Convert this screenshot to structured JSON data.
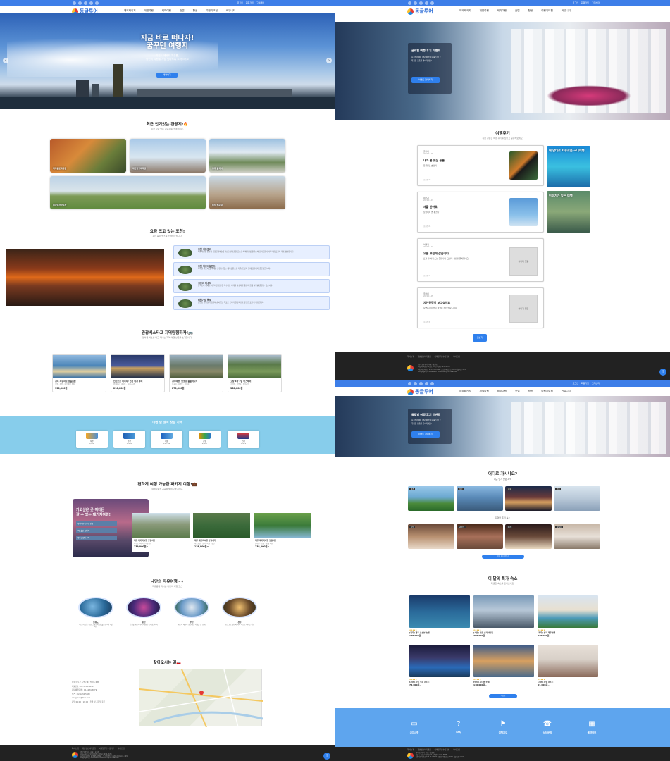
{
  "brand": {
    "logo_text": "동글투어"
  },
  "topbar": {
    "util": [
      "로그인",
      "회원가입",
      "고객센터"
    ]
  },
  "nav": {
    "menu": [
      "해외패키지",
      "개별여행",
      "테마여행",
      "호텔",
      "항공",
      "여행지보험",
      "커뮤니티"
    ]
  },
  "home": {
    "hero": {
      "line1": "지금 바로 떠나자!",
      "line2": "꿈꾸던 여행지",
      "sub1": "지친 나에게도 자유를,",
      "sub2": "당신의 여행을 가장 빛나도록 도와드려요",
      "button": "예약하기"
    },
    "popular": {
      "title": "최근 인기있는 관광지!🔥",
      "sub": "지금 사랑 받는 관광지를 소개합니다.",
      "items": [
        "제주돌문화공원",
        "대관령양떼목장",
        "경주 불국사",
        "울산 간절곶",
        "대관령삼양목장",
        "부산 해운대"
      ]
    },
    "recommend": {
      "title": "요즘 뜨고 있는 포천!",
      "sub": "포천 숨은 명소를 소개해드립니다.",
      "items": [
        {
          "name": "포천 아트밸리",
          "desc": "폐채석장을 친환경 복합문화예술공간으로 탈바꿈한 곳으로 에메랄드빛 천주호와 조각공원이 어우러진 포천의 대표 명소입니다."
        },
        {
          "name": "포천 허브아일랜드",
          "desc": "사계절 허브와 빛 축제를 즐길 수 있는 테마공원으로 가족, 연인과 함께 방문하기 좋은 곳입니다."
        },
        {
          "name": "고모리 저수지",
          "desc": "산책로와 카페가 어우러진 조용한 저수지로 사계절 아름다운 풍경과 함께 여유를 즐길 수 있습니다."
        },
        {
          "name": "비둘기낭 폭포",
          "desc": "한탄강 주상절리 협곡에 숨어있는 폭포로 드라마 촬영지로도 유명한 포천의 비경입니다."
        }
      ]
    },
    "tours": {
      "title": "관광버스타고 지역탐험하자!🚌",
      "sub": "편하게 버스를 타고 떠나는 지역 여행 상품을 소개합니다.",
      "items": [
        {
          "name": "경북 자동차로 당일출발",
          "sub": "포항 · 경주 · 울산 해안 투어",
          "price": "138,000원~"
        },
        {
          "name": "인천으로 떠나자! 인천 야경 투어",
          "sub": "인천대교 · 월미도 · 차이나타운",
          "price": "210,000원~"
        },
        {
          "name": "경주여행, 안호로 출발하자!",
          "sub": "불국사 · 석굴암 · 첨성대",
          "price": "273,000원~"
        },
        {
          "name": "고창 1박 2일 버스투어",
          "sub": "고인돌 · 선운사 · 청보리밭",
          "price": "358,000원~"
        }
      ]
    },
    "regions": {
      "title": "이번 달 많이 찾은 지역",
      "items": [
        {
          "name": "제주",
          "value": "3,250"
        },
        {
          "name": "부산",
          "value": "5,420"
        },
        {
          "name": "서울",
          "value": "15,769"
        },
        {
          "name": "강원",
          "value": "2,457"
        },
        {
          "name": "인천",
          "value": "3,474"
        }
      ]
    },
    "package": {
      "title": "편하게 여행 가능한 패키지 여행!💼",
      "sub": "여행상품을 꼼꼼하게 비교해드려요.",
      "promo_line1": "가고싶은 곳 어디든",
      "promo_line2": "갈 수 있는 패키지여행!",
      "options": [
        "해외여행 패키지, 전체",
        "2명 출발, 성인2",
        "예약 출발일, 1박"
      ],
      "items": [
        {
          "name": "제주 패키지여행 당일치기",
          "sub": "제주도 2박 3일 자유여행",
          "price": "139,000원~"
        },
        {
          "name": "제주 패키지여행 당일치기",
          "sub": "미로공원 · 동백수목원 · 성산",
          "price": "138,000원~"
        },
        {
          "name": "제주 패키지여행 당일치기",
          "sub": "한라산 · 오름 · 협재 해변",
          "price": "138,000원~"
        }
      ]
    },
    "free": {
      "title": "나만의 자유여행~✈",
      "sub": "자유롭게 떠나는 나만의 여행 코스",
      "items": [
        {
          "name": "울릉도",
          "desc": "때 묻지 않은 자연 그대로의 섬, 울릉도 2박 3일 여행"
        },
        {
          "name": "울산",
          "desc": "간절곶 해돋이부터 태화강 국가정원까지"
        },
        {
          "name": "부산",
          "desc": "해운대 해변과 광안대교 야경을 한 번에"
        },
        {
          "name": "경주",
          "desc": "천년 고도 경주의 역사 속으로 떠나는 여행"
        }
      ]
    },
    "location": {
      "title": "찾아오시는 길🚗",
      "lines": [
        "서울 마포구 독막로 67 망원동 686",
        "대표번호 : 02-1234-5678",
        "대량예약문의 : 02-1234-5679",
        "팩스 : 02-1234-5680",
        "dongglue@tour.com",
        "평일 09:00 - 18:00 · 주말 및 공휴일 휴무"
      ]
    }
  },
  "review": {
    "hero": {
      "title": "글로벌 여행 후기 이벤트",
      "desc1": "동글투어에서 떠난 여행 후기를 남기고",
      "desc2": "푸짐한 경품을 받아가세요!",
      "button": "이벤트 참여하기"
    },
    "section": {
      "title": "여행후기",
      "sub": "직접 경험한 여행 후기를 남기고 공유해보세요."
    },
    "items": [
      {
        "user": "글쓴이",
        "date": "2022-11-09",
        "head": "내가 본 멋진 동물",
        "body": "동물원도 호랑이",
        "views": "조회수 26",
        "image": true
      },
      {
        "user": "여우개",
        "date": "2022-11-07",
        "head": "새를 받아요",
        "body": "남극에서 본 펭귄들",
        "views": "조회수 21",
        "image": true
      },
      {
        "user": "여행객",
        "date": "2022-11-07",
        "head": "오늘 포천에 갑습니다.",
        "body": "포천 한 바퀴 도는 중입니다. 그런데 사진을 못찍었네요",
        "views": "조회수 11",
        "image": false,
        "noimg": "이미지 없음"
      },
      {
        "user": "글쓴이",
        "date": "2022-11-05",
        "head": "자연풍경이 보고싶어요",
        "body": "자연풍경이 좋은 여행지 추천 부탁드려요",
        "views": "조회수 3",
        "image": false,
        "noimg": "이미지 없음"
      }
    ],
    "side": [
      "내 맘대로 자유로운 국내여행",
      "이야기가 있는 여행"
    ],
    "write": "글쓰기"
  },
  "search": {
    "title": "어디로 가시나요?",
    "sub1": "최근 인기 많은 지역",
    "dest": [
      "제주",
      "부산",
      "서울",
      "인천"
    ],
    "sub2": "다양한 추천 숙소",
    "hotels": [
      "호텔",
      "리조트",
      "펜션",
      "풀빌라"
    ],
    "more_button": "인기 숙소 더보기",
    "special": {
      "title": "이 달의 특가 숙소",
      "sub": "특별한 숙소를 만나보세요.",
      "items": [
        {
          "name": "[제주] 제주 오션뷰 호텔",
          "price": "128,000원~"
        },
        {
          "name": "[서울] 서울 스카이타워",
          "price": "258,000원~"
        },
        {
          "name": "[제주] 신라 제주호텔",
          "price": "428,000원~"
        },
        {
          "name": "[강원] 강원 스파 리조트",
          "price": "78,000원~"
        },
        {
          "name": "[부산] 시티뷰 호텔",
          "price": "110,000원~"
        },
        {
          "name": "[강원] 강원 리조트",
          "price": "97,000원~"
        }
      ]
    },
    "more_button2": "더보기",
    "quick": [
      "공지사항",
      "FAQ",
      "여행지도",
      "상담문의",
      "예약정보"
    ]
  },
  "footer": {
    "links": [
      "회사소개",
      "개인정보처리방침",
      "이메일무단수집거부",
      "사이트맵"
    ],
    "lines": [
      "(주) 동글투어 · 대표 : 홍길동",
      "서울시 마포구 독막로 67 고객센터 1234-5678",
      "사업자등록번호 123-45-67890 · 통신판매업신고 2022-서울마포-1234",
      "Copyright (c) DONGGLE TOUR. All rights reserved."
    ]
  },
  "colors": {
    "primary": "#3d7ee8",
    "button": "#2f80ed",
    "light_blue": "#87cdeb",
    "quick_bar": "#5ea5ee",
    "footer": "#222222"
  }
}
